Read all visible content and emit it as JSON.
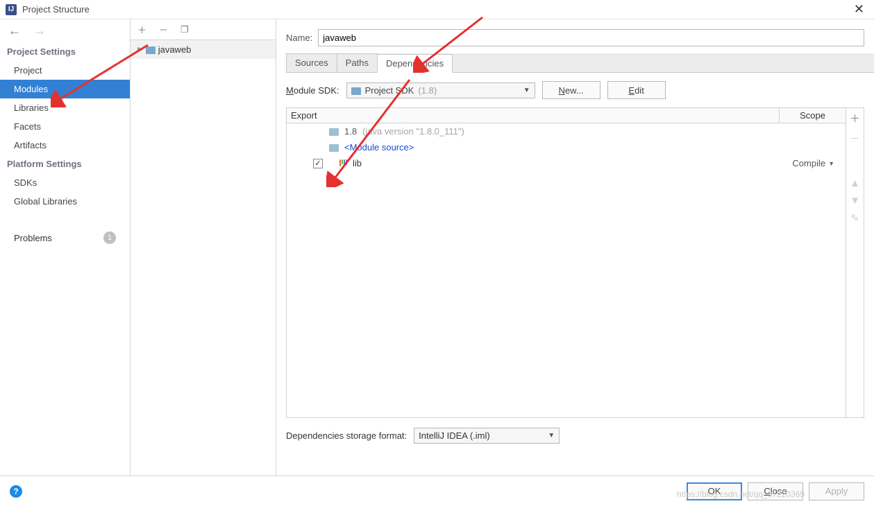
{
  "window": {
    "title": "Project Structure"
  },
  "left": {
    "section1": "Project Settings",
    "items1": [
      "Project",
      "Modules",
      "Libraries",
      "Facets",
      "Artifacts"
    ],
    "selected": "Modules",
    "section2": "Platform Settings",
    "items2": [
      "SDKs",
      "Global Libraries"
    ],
    "problems_label": "Problems",
    "problems_count": "1"
  },
  "tree": {
    "item": "javaweb"
  },
  "name": {
    "label": "Name:",
    "value": "javaweb"
  },
  "tabs": {
    "t0": "Sources",
    "t1": "Paths",
    "t2": "Dependencies"
  },
  "sdk": {
    "label_pre": "M",
    "label_u": "odule SDK:",
    "value": "Project SDK",
    "value_sub": " (1.8)",
    "new_u": "N",
    "new_rest": "ew...",
    "edit_u": "E",
    "edit_rest": "dit"
  },
  "deps": {
    "col_export": "Export",
    "col_scope": "Scope",
    "row1_main": "1.8",
    "row1_sub": " (java version \"1.8.0_111\")",
    "row2": "<Module source>",
    "row3": "lib",
    "row3_scope": "Compile"
  },
  "storage": {
    "label": "Dependencies storage format:",
    "value": "IntelliJ IDEA (.iml)"
  },
  "footer": {
    "ok": "OK",
    "close_u": "C",
    "close_rest": "lose",
    "apply": "Apply"
  },
  "watermark": "https://blog.csdn.net/qq_37220369"
}
